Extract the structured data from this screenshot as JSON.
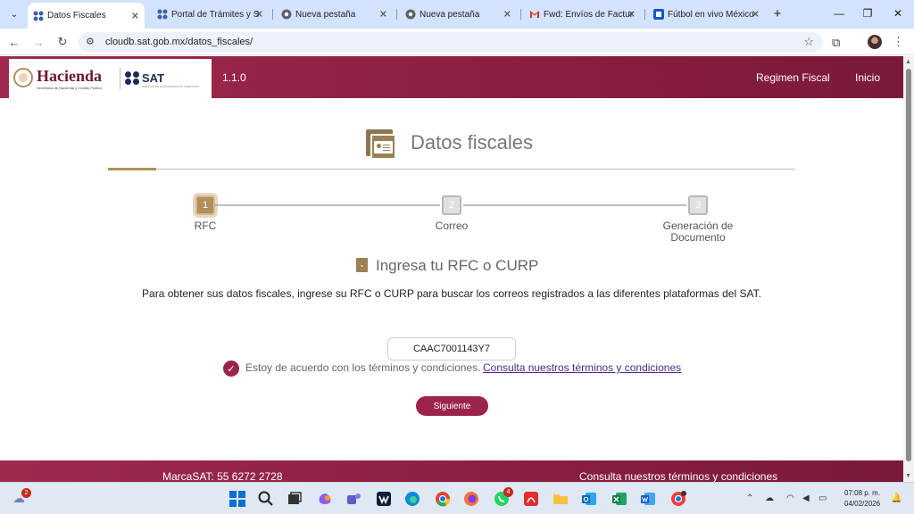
{
  "browser": {
    "tabs": [
      {
        "label": "Datos Fiscales",
        "active": true,
        "favicon": "sat-grid-icon"
      },
      {
        "label": "Portal de Trámites y S",
        "active": false,
        "favicon": "sat-grid-icon"
      },
      {
        "label": "Nueva pestaña",
        "active": false,
        "favicon": "chrome-icon"
      },
      {
        "label": "Nueva pestaña",
        "active": false,
        "favicon": "chrome-icon"
      },
      {
        "label": "Fwd: Envíos de Factur",
        "active": false,
        "favicon": "gmail-icon"
      },
      {
        "label": "Fútbol en vivo México",
        "active": false,
        "favicon": "soccer-icon"
      }
    ],
    "url": "cloudb.sat.gob.mx/datos_fiscales/"
  },
  "header": {
    "logo_hacienda": "Hacienda",
    "logo_hacienda_sub": "Secretaría de Hacienda y Crédito Público",
    "logo_sat": "SAT",
    "logo_sat_sub": "SERVICIO DE ADMINISTRACIÓN TRIBUTARIA",
    "version": "1.1.0",
    "nav": [
      "Regimen Fiscal",
      "Inicio"
    ]
  },
  "main": {
    "title": "Datos fiscales",
    "steps": [
      {
        "number": "1",
        "label": "RFC"
      },
      {
        "number": "2",
        "label": "Correo"
      },
      {
        "number": "3",
        "label": "Generación de Documento"
      }
    ],
    "form_title": "Ingresa tu RFC o CURP",
    "intro": "Para obtener sus datos fiscales, ingrese su RFC o CURP para buscar los correos registrados a las diferentes plataformas del SAT.",
    "rfc_value": "CAAC7001143Y7",
    "terms_text": "Estoy de acuerdo con los términos y condiciones.",
    "terms_link": "Consulta nuestros términos y condiciones",
    "next_button": "Siguiente"
  },
  "footer": {
    "left": "MarcaSAT:  55 6272 2728",
    "right": "Consulta nuestros términos y condiciones"
  },
  "taskbar": {
    "weather_badge": "2",
    "whatsapp_badge": "4",
    "time": "07:08 p. m.",
    "date": "04/02/2026"
  },
  "colors": {
    "brand": "#9d2449",
    "accent": "#b38e5d"
  }
}
